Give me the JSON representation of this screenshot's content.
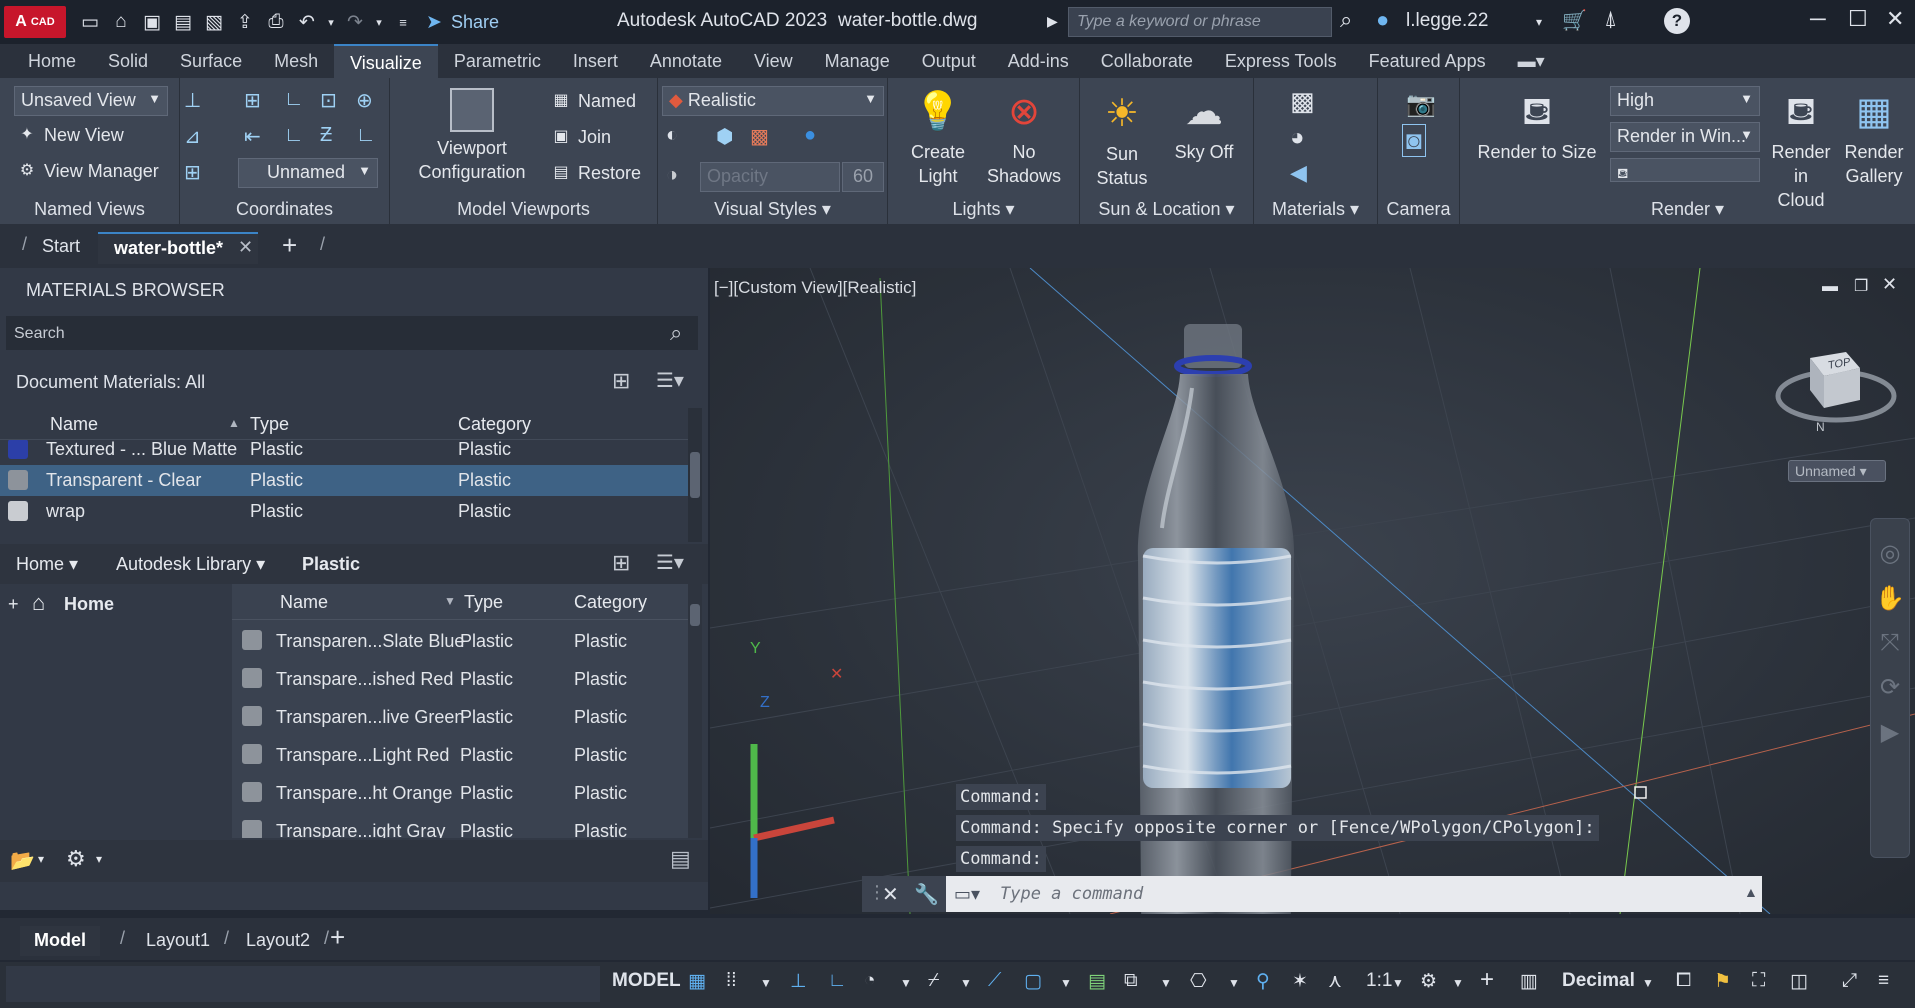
{
  "titlebar": {
    "logo_text": "CAD",
    "logo_letter": "A",
    "share_label": "Share",
    "app_title": "Autodesk AutoCAD 2023",
    "file_name": "water-bottle.dwg",
    "search_placeholder": "Type a keyword or phrase",
    "user_name": "l.legge.22",
    "help_label": "?"
  },
  "ribbon_tabs": [
    "Home",
    "Solid",
    "Surface",
    "Mesh",
    "Visualize",
    "Parametric",
    "Insert",
    "Annotate",
    "View",
    "Manage",
    "Output",
    "Add-ins",
    "Collaborate",
    "Express Tools",
    "Featured Apps"
  ],
  "active_tab": "Visualize",
  "named_views": {
    "title": "Named Views",
    "current_view": "Unsaved View",
    "new_view": "New View",
    "view_manager": "View Manager"
  },
  "coordinates": {
    "title": "Coordinates",
    "ucs": "Unnamed"
  },
  "model_viewports": {
    "title": "Model Viewports",
    "config_line1": "Viewport",
    "config_line2": "Configuration",
    "named": "Named",
    "join": "Join",
    "restore": "Restore"
  },
  "visual_styles": {
    "title": "Visual Styles",
    "style": "Realistic",
    "opacity_label": "Opacity",
    "opacity_value": "60"
  },
  "lights": {
    "title": "Lights",
    "create_line1": "Create",
    "create_line2": "Light",
    "shadows_line1": "No",
    "shadows_line2": "Shadows"
  },
  "sun_location": {
    "title": "Sun & Location",
    "sun_line1": "Sun",
    "sun_line2": "Status",
    "sky": "Sky Off"
  },
  "materials": {
    "title": "Materials"
  },
  "camera": {
    "title": "Camera"
  },
  "render": {
    "title": "Render",
    "render_size": "Render to Size",
    "quality": "High",
    "render_in": "Render in Win...",
    "cloud_line1": "Render in",
    "cloud_line2": "Cloud",
    "gallery_line1": "Render",
    "gallery_line2": "Gallery"
  },
  "file_tabs": {
    "start": "Start",
    "active": "water-bottle*"
  },
  "materials_browser": {
    "title": "MATERIALS BROWSER",
    "search_placeholder": "Search",
    "doc_label": "Document Materials: All",
    "headers": {
      "name": "Name",
      "type": "Type",
      "category": "Category"
    },
    "doc_rows": [
      {
        "name": "Textured - ... Blue Matte",
        "type": "Plastic",
        "category": "Plastic",
        "color": "#2c3fa8"
      },
      {
        "name": "Transparent - Clear",
        "type": "Plastic",
        "category": "Plastic",
        "color": "#8d939b"
      },
      {
        "name": "wrap",
        "type": "Plastic",
        "category": "Plastic",
        "color": "#c9ccd1"
      }
    ],
    "lib_bar": {
      "home": "Home",
      "library": "Autodesk Library",
      "category": "Plastic"
    },
    "tree_home": "Home",
    "lib_rows": [
      {
        "name": "Transparen...Slate Blue",
        "type": "Plastic",
        "category": "Plastic"
      },
      {
        "name": "Transpare...ished Red",
        "type": "Plastic",
        "category": "Plastic"
      },
      {
        "name": "Transparen...live Green",
        "type": "Plastic",
        "category": "Plastic"
      },
      {
        "name": "Transpare...Light Red",
        "type": "Plastic",
        "category": "Plastic"
      },
      {
        "name": "Transpare...ht Orange",
        "type": "Plastic",
        "category": "Plastic"
      },
      {
        "name": "Transpare...ight Gray",
        "type": "Plastic",
        "category": "Plastic"
      }
    ]
  },
  "viewport": {
    "label": "[−][Custom View][Realistic]",
    "viewcube_top": "TOP",
    "ucs_name": "Unnamed",
    "axis_y": "Y",
    "axis_x": "X",
    "axis_z": "Z"
  },
  "command": {
    "history": [
      "Command:",
      "Command: Specify opposite corner or [Fence/WPolygon/CPolygon]:",
      "Command:"
    ],
    "placeholder": "Type a command"
  },
  "layout_tabs": [
    "Model",
    "Layout1",
    "Layout2"
  ],
  "statusbar": {
    "model": "MODEL",
    "scale": "1:1",
    "units": "Decimal"
  }
}
